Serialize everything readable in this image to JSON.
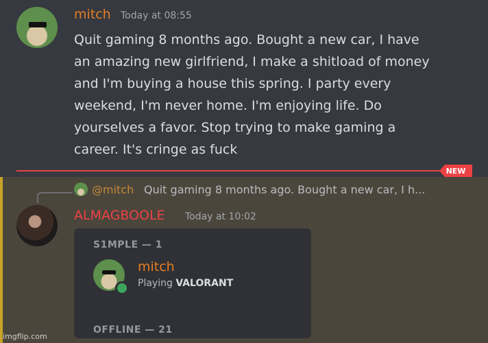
{
  "message1": {
    "author": "mitch",
    "author_color": "#e67e22",
    "timestamp": "Today at 08:55",
    "lines": [
      "Quit gaming 8 months ago. Bought a new car, I have",
      "an amazing new girlfriend, I make a shitload of money",
      "and I'm buying a house this spring. I party every",
      "weekend, I'm never home. I'm enjoying life. Do",
      "yourselves a favor. Stop trying to make gaming a",
      "career. It's cringe as fuck"
    ]
  },
  "divider": {
    "badge": "NEW",
    "color": "#ed4245"
  },
  "message2": {
    "reply": {
      "mention": "@mitch",
      "preview": "Quit gaming 8 months ago. Bought a new car, I h..."
    },
    "author": "ALMAGBOOLE",
    "author_color": "#ed4245",
    "timestamp": "Today at 10:02",
    "embed": {
      "group1_header": "S1MPLE — 1",
      "member_name": "mitch",
      "activity_prefix": "Playing",
      "activity_game": "VALORANT",
      "group2_header": "OFFLINE — 21",
      "status": "online-dot-icon"
    }
  },
  "watermark": "imgflip.com"
}
